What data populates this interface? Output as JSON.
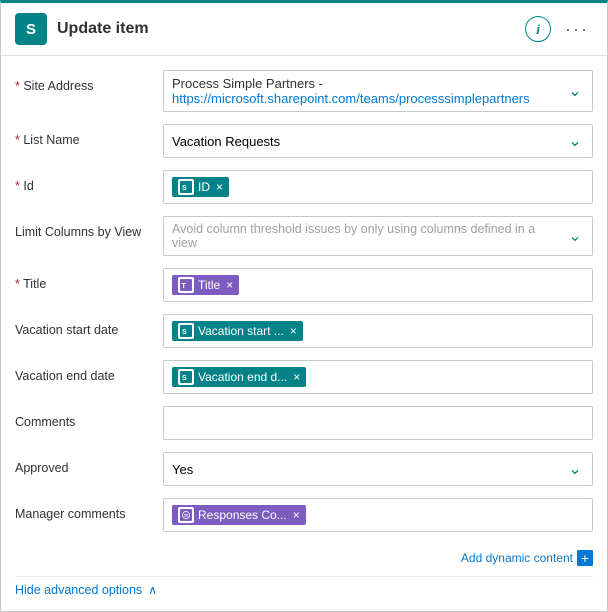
{
  "header": {
    "icon_letter": "S",
    "title": "Update item",
    "info_label": "i",
    "more_label": "···"
  },
  "form": {
    "fields": [
      {
        "id": "site-address",
        "label": "* Site Address",
        "required": true,
        "type": "site-address",
        "value_label": "Process Simple Partners -",
        "value_url": "https://microsoft.sharepoint.com/teams/processsimplepartners"
      },
      {
        "id": "list-name",
        "label": "* List Name",
        "required": true,
        "type": "dropdown",
        "value": "Vacation Requests"
      },
      {
        "id": "id",
        "label": "* Id",
        "required": true,
        "type": "tags",
        "tags": [
          {
            "label": "ID",
            "icon_type": "sharepoint",
            "closeable": true
          }
        ]
      },
      {
        "id": "limit-columns",
        "label": "Limit Columns by View",
        "required": false,
        "type": "dropdown-placeholder",
        "placeholder": "Avoid column threshold issues by only using columns defined in a view"
      },
      {
        "id": "title",
        "label": "* Title",
        "required": true,
        "type": "tags",
        "tags": [
          {
            "label": "Title",
            "icon_type": "purple",
            "closeable": true
          }
        ]
      },
      {
        "id": "vacation-start",
        "label": "Vacation start date",
        "required": false,
        "type": "tags",
        "tags": [
          {
            "label": "Vacation start ...",
            "icon_type": "sharepoint",
            "closeable": true
          }
        ]
      },
      {
        "id": "vacation-end",
        "label": "Vacation end date",
        "required": false,
        "type": "tags",
        "tags": [
          {
            "label": "Vacation end d...",
            "icon_type": "sharepoint",
            "closeable": true
          }
        ]
      },
      {
        "id": "comments",
        "label": "Comments",
        "required": false,
        "type": "empty"
      },
      {
        "id": "approved",
        "label": "Approved",
        "required": false,
        "type": "dropdown",
        "value": "Yes"
      },
      {
        "id": "manager-comments",
        "label": "Manager comments",
        "required": false,
        "type": "tags",
        "tags": [
          {
            "label": "Responses Co...",
            "icon_type": "purple-shield",
            "closeable": true
          }
        ]
      }
    ]
  },
  "footer": {
    "add_dynamic_label": "Add dynamic content",
    "hide_advanced_label": "Hide advanced options"
  }
}
